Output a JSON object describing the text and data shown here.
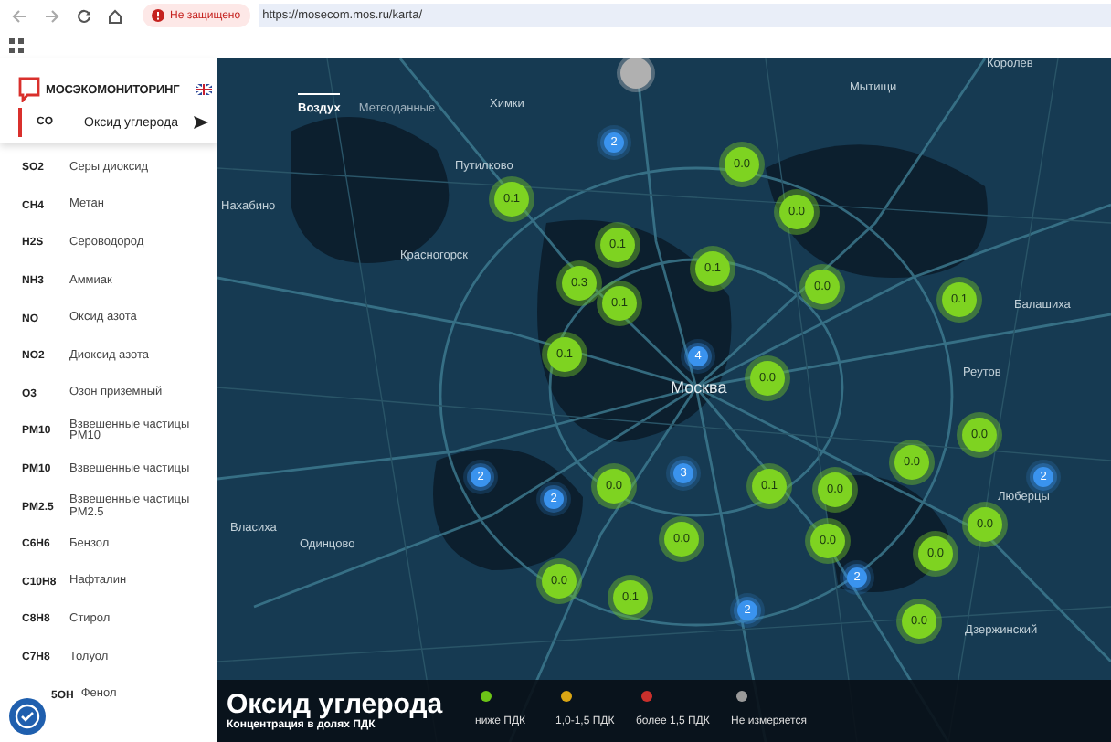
{
  "browser": {
    "security_badge": "Не защищено",
    "url": "https://mosecom.mos.ru/karta/"
  },
  "sidebar": {
    "logo_text": "МОСЭКОМОНИТОРИНГ",
    "selected": {
      "code": "CO",
      "name": "Оксид углерода"
    },
    "items": [
      {
        "code": "SO2",
        "name": "Серы диоксид"
      },
      {
        "code": "CH4",
        "name": "Метан"
      },
      {
        "code": "H2S",
        "name": "Сероводород"
      },
      {
        "code": "NH3",
        "name": "Аммиак"
      },
      {
        "code": "NO",
        "name": "Оксид азота"
      },
      {
        "code": "NO2",
        "name": "Диоксид азота"
      },
      {
        "code": "O3",
        "name": "Озон приземный"
      },
      {
        "code": "PM10",
        "name": "Взвешенные частицы PM10"
      },
      {
        "code": "PM10",
        "name": "Взвешенные частицы"
      },
      {
        "code": "PM2.5",
        "name": "Взвешенные частицы PM2.5"
      },
      {
        "code": "C6H6",
        "name": "Бензол"
      },
      {
        "code": "C10H8",
        "name": "Нафталин"
      },
      {
        "code": "C8H8",
        "name": "Стирол"
      },
      {
        "code": "C7H8",
        "name": "Толуол"
      },
      {
        "code": "5OH",
        "name": "Фенол"
      }
    ]
  },
  "map": {
    "tabs": [
      {
        "label": "Воздух",
        "selected": true
      },
      {
        "label": "Метеоданные",
        "selected": false
      }
    ],
    "places": [
      "Королев",
      "Мытищи",
      "Химки",
      "Путилково",
      "Нахабино",
      "Красногорск",
      "Балашиха",
      "Реутов",
      "Москва",
      "Люберцы",
      "Власиха",
      "Одинцово",
      "Дзержинский"
    ],
    "markers": [
      {
        "kind": "unmeasured"
      },
      {
        "kind": "cluster",
        "value": "2"
      },
      {
        "kind": "station",
        "value": "0.0"
      },
      {
        "kind": "station",
        "value": "0.1"
      },
      {
        "kind": "station",
        "value": "0.0"
      },
      {
        "kind": "station",
        "value": "0.1"
      },
      {
        "kind": "station",
        "value": "0.3"
      },
      {
        "kind": "station",
        "value": "0.1"
      },
      {
        "kind": "station",
        "value": "0.1"
      },
      {
        "kind": "station",
        "value": "0.0"
      },
      {
        "kind": "station",
        "value": "0.1"
      },
      {
        "kind": "station",
        "value": "0.1"
      },
      {
        "kind": "cluster",
        "value": "4"
      },
      {
        "kind": "station",
        "value": "0.0"
      },
      {
        "kind": "station",
        "value": "0.0"
      },
      {
        "kind": "station",
        "value": "0.0"
      },
      {
        "kind": "cluster",
        "value": "2"
      },
      {
        "kind": "cluster",
        "value": "2"
      },
      {
        "kind": "station",
        "value": "0.0"
      },
      {
        "kind": "cluster",
        "value": "3"
      },
      {
        "kind": "station",
        "value": "0.1"
      },
      {
        "kind": "station",
        "value": "0.0"
      },
      {
        "kind": "cluster",
        "value": "2"
      },
      {
        "kind": "station",
        "value": "0.0"
      },
      {
        "kind": "station",
        "value": "0.0"
      },
      {
        "kind": "station",
        "value": "0.0"
      },
      {
        "kind": "station",
        "value": "0.0"
      },
      {
        "kind": "station",
        "value": "0.0"
      },
      {
        "kind": "cluster",
        "value": "2"
      },
      {
        "kind": "station",
        "value": "0.1"
      },
      {
        "kind": "cluster",
        "value": "2"
      },
      {
        "kind": "station",
        "value": "0.0"
      }
    ],
    "legend": {
      "title": "Оксид углерода",
      "subtitle": "Концентрация в долях ПДК",
      "items": [
        {
          "label": "ниже ПДК",
          "color": "#6cc417"
        },
        {
          "label": "1,0-1,5 ПДК",
          "color": "#d9a514"
        },
        {
          "label": "более 1,5 ПДК",
          "color": "#c9302c"
        },
        {
          "label": "Не измеряется",
          "color": "#9a9a9a"
        }
      ]
    }
  }
}
